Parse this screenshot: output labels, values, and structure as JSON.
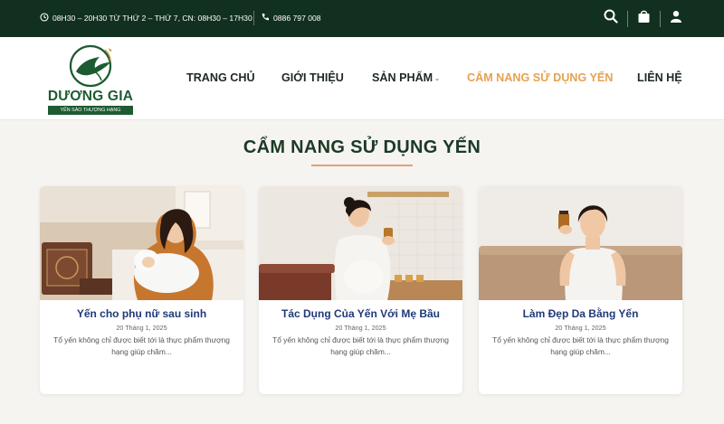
{
  "topbar": {
    "hours": "08H30 – 20H30 TỪ THỨ 2 – THỨ 7, CN: 08H30 – 17H30",
    "phone": "0886 797 008",
    "icons": [
      "clock-icon",
      "phone-icon",
      "search-icon",
      "shopping-bag-icon",
      "user-icon"
    ]
  },
  "logo": {
    "brand": "DƯƠNG GIA",
    "tagline": "YẾN SÀO THƯỢNG HẠNG"
  },
  "nav": {
    "items": [
      {
        "label": "TRANG CHỦ"
      },
      {
        "label": "GIỚI THIỆU"
      },
      {
        "label": "SẢN PHẨM"
      },
      {
        "label": "CẨM NANG SỬ DỤNG YẾN"
      },
      {
        "label": "LIÊN HỆ"
      }
    ]
  },
  "section": {
    "title": "CẨM NANG SỬ DỤNG YẾN"
  },
  "posts": [
    {
      "title": "Yến cho phụ nữ sau sinh",
      "date": "20 Tháng 1, 2025",
      "excerpt": "Tổ yến không chỉ được biết tới là thực phẩm thượng hạng giúp chăm..."
    },
    {
      "title": "Tác Dụng Của Yến Với Mẹ Bầu",
      "date": "20 Tháng 1, 2025",
      "excerpt": "Tổ yến không chỉ được biết tới là thực phẩm thượng hạng giúp chăm..."
    },
    {
      "title": "Làm Đẹp Da Bằng Yến",
      "date": "20 Tháng 1, 2025",
      "excerpt": "Tổ yến không chỉ được biết tới là thực phẩm thượng hạng giúp chăm..."
    }
  ],
  "colors": {
    "topbar": "#11301f",
    "brand_green": "#1d5b32",
    "nav_active": "#e6a24f",
    "card_title": "#1f3a7a"
  }
}
